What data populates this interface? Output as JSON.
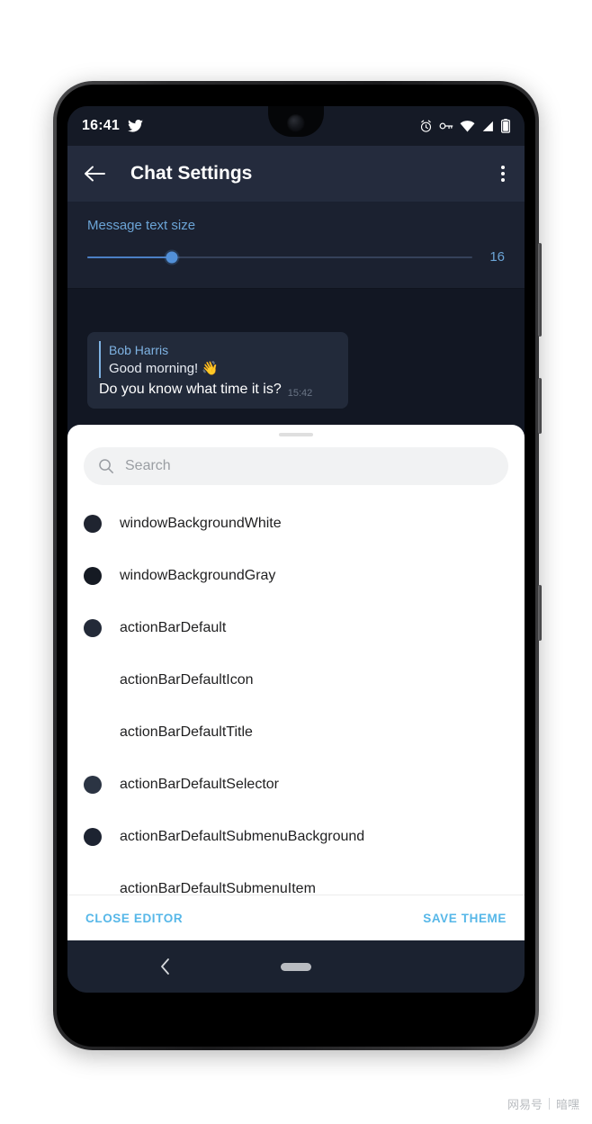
{
  "status_bar": {
    "time": "16:41",
    "left_icons": [
      "twitter-bird-icon"
    ],
    "right_icons": [
      "alarm-icon",
      "vpn-key-icon",
      "wifi-icon",
      "signal-icon",
      "battery-icon"
    ]
  },
  "app_bar": {
    "back_icon": "back-arrow-icon",
    "title": "Chat Settings",
    "overflow_icon": "more-vertical-icon"
  },
  "text_size_section": {
    "label": "Message text size",
    "value": "16",
    "slider_percent": 22,
    "accent_color": "#6ba4d6"
  },
  "chat_preview": {
    "reply": {
      "name": "Bob Harris",
      "text": "Good morning! 👋"
    },
    "message": "Do you know what time it is?",
    "time": "15:42"
  },
  "sheet": {
    "handle": "drag-handle",
    "search": {
      "placeholder": "Search",
      "value": "",
      "icon": "search-icon"
    },
    "items": [
      {
        "name": "windowBackgroundWhite",
        "has_swatch": true,
        "color": "#1f2430"
      },
      {
        "name": "windowBackgroundGray",
        "has_swatch": true,
        "color": "#151a23"
      },
      {
        "name": "actionBarDefault",
        "has_swatch": true,
        "color": "#232a38"
      },
      {
        "name": "actionBarDefaultIcon",
        "has_swatch": false,
        "color": ""
      },
      {
        "name": "actionBarDefaultTitle",
        "has_swatch": false,
        "color": ""
      },
      {
        "name": "actionBarDefaultSelector",
        "has_swatch": true,
        "color": "#2b3443"
      },
      {
        "name": "actionBarDefaultSubmenuBackground",
        "has_swatch": true,
        "color": "#1d2331"
      },
      {
        "name": "actionBarDefaultSubmenuItem",
        "has_swatch": false,
        "color": ""
      }
    ],
    "footer": {
      "close_label": "CLOSE EDITOR",
      "save_label": "SAVE THEME",
      "link_color": "#56b7e8"
    }
  },
  "nav_bar": {
    "back_icon": "nav-back-chevron-icon",
    "home_icon": "home-pill-icon"
  },
  "watermark": {
    "brand": "网易号",
    "author": "暗嘿"
  }
}
